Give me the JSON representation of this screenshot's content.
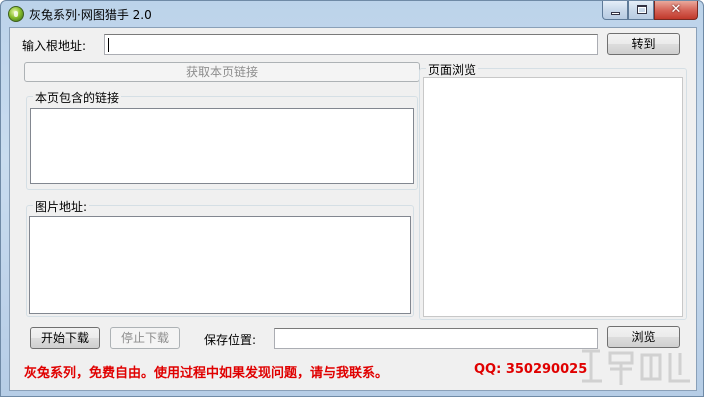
{
  "window": {
    "title": "灰兔系列·网图猎手 2.0"
  },
  "url_row": {
    "label": "输入根地址:",
    "value": "",
    "go_button": "转到"
  },
  "fetch_button": "获取本页链接",
  "links_group": {
    "title": "本页包含的链接"
  },
  "images_group": {
    "title": "图片地址:"
  },
  "preview_group": {
    "title": "页面浏览"
  },
  "bottom_bar": {
    "start_button": "开始下载",
    "stop_button": "停止下载",
    "save_label": "保存位置:",
    "save_value": "",
    "browse_button": "浏览"
  },
  "footer": {
    "notice": "灰兔系列，免费自由。使用过程中如果发现问题，请与我联系。",
    "qq": "QQ: 350290025"
  },
  "colors": {
    "notice_red": "#e00000",
    "window_frame": "#bcd3ea",
    "client_bg": "#f0f0f0"
  },
  "icons": {
    "app": "rabbit-app-icon",
    "minimize": "minimize-icon",
    "maximize": "maximize-icon",
    "close": "close-icon"
  }
}
